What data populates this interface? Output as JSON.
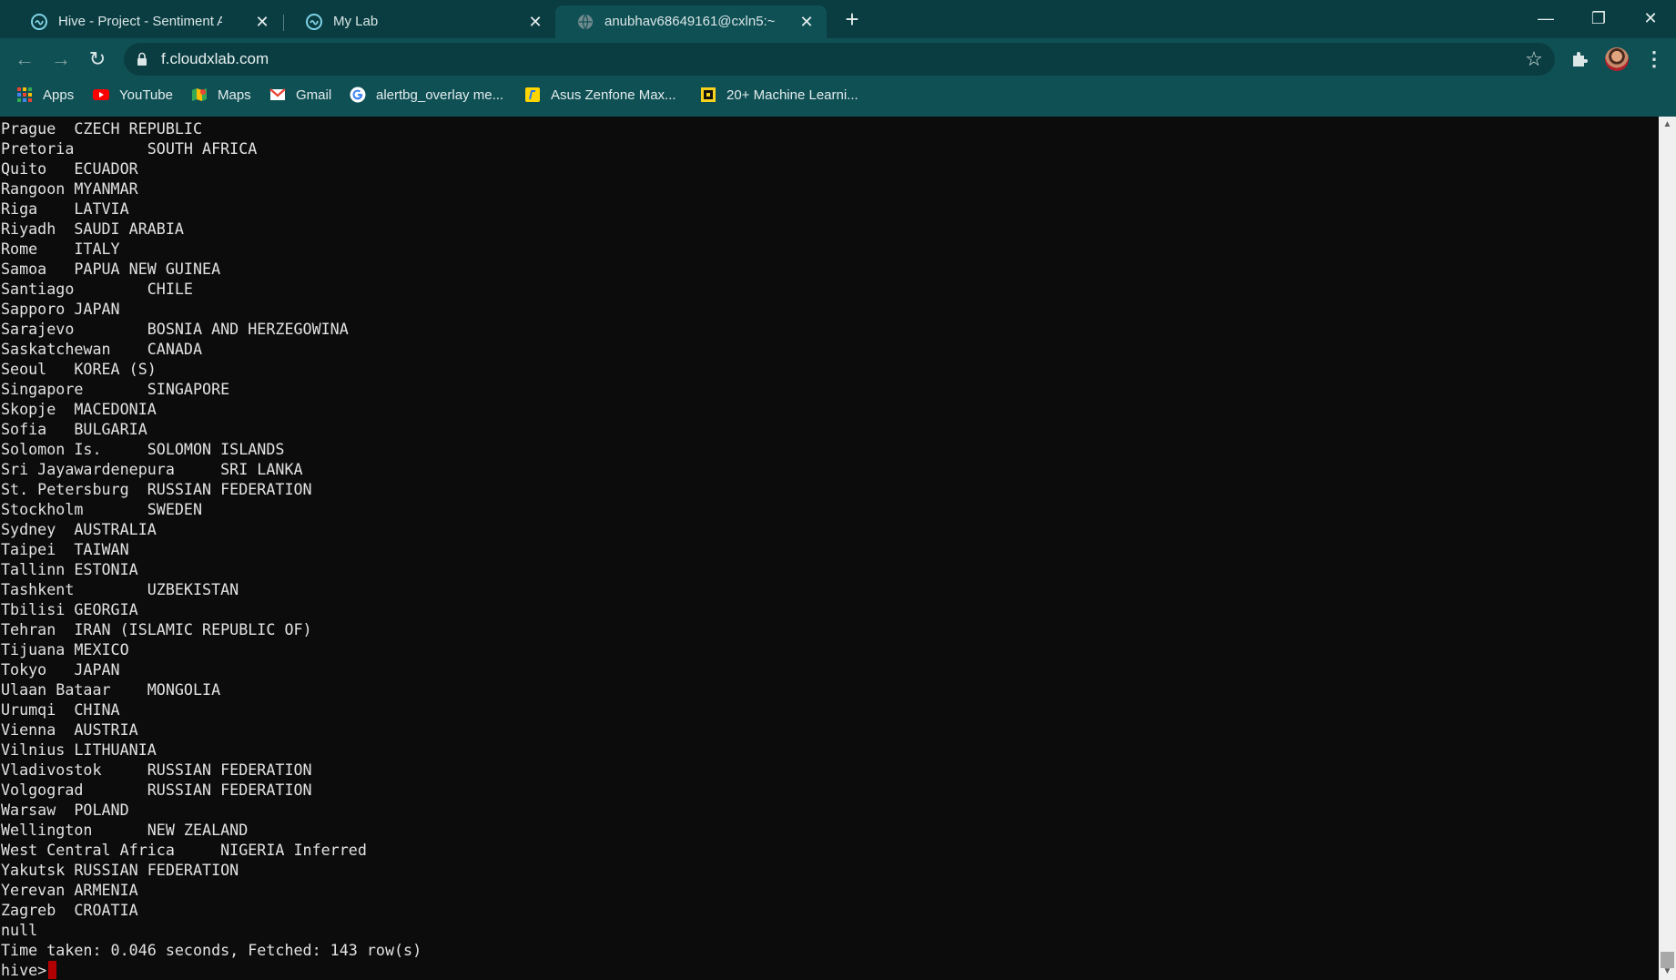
{
  "browser": {
    "tabs": [
      {
        "title": "Hive - Project - Sentiment Analys",
        "favicon": "cloudxlab-icon",
        "active": false
      },
      {
        "title": "My Lab",
        "favicon": "cloudxlab-icon",
        "active": false
      },
      {
        "title": "anubhav68649161@cxln5:~",
        "favicon": "globe-icon",
        "active": true
      }
    ],
    "close_glyph": "✕",
    "new_tab_glyph": "+",
    "window_controls": {
      "minimize": "—",
      "restore": "❐",
      "close": "✕"
    },
    "url": "f.cloudxlab.com",
    "nav": {
      "back": "←",
      "forward": "→",
      "reload": "↻",
      "star": "☆",
      "menu": "⋮"
    },
    "bookmarks": [
      {
        "label": "Apps",
        "icon": "apps-grid-icon"
      },
      {
        "label": "YouTube",
        "icon": "youtube-icon"
      },
      {
        "label": "Maps",
        "icon": "maps-icon"
      },
      {
        "label": "Gmail",
        "icon": "gmail-icon"
      },
      {
        "label": "alertbg_overlay me...",
        "icon": "google-icon"
      },
      {
        "label": "Asus Zenfone Max...",
        "icon": "flipkart-icon"
      },
      {
        "label": "20+ Machine Learni...",
        "icon": "site-icon"
      }
    ],
    "colors": {
      "frame": "#0a3d41",
      "toolbar": "#0f5055",
      "cursor": "#b30000"
    }
  },
  "terminal": {
    "lines": [
      "Prague  CZECH REPUBLIC",
      "Pretoria        SOUTH AFRICA",
      "Quito   ECUADOR",
      "Rangoon MYANMAR",
      "Riga    LATVIA",
      "Riyadh  SAUDI ARABIA",
      "Rome    ITALY",
      "Samoa   PAPUA NEW GUINEA",
      "Santiago        CHILE",
      "Sapporo JAPAN",
      "Sarajevo        BOSNIA AND HERZEGOWINA",
      "Saskatchewan    CANADA",
      "Seoul   KOREA (S)",
      "Singapore       SINGAPORE",
      "Skopje  MACEDONIA",
      "Sofia   BULGARIA",
      "Solomon Is.     SOLOMON ISLANDS",
      "Sri Jayawardenepura     SRI LANKA",
      "St. Petersburg  RUSSIAN FEDERATION",
      "Stockholm       SWEDEN",
      "Sydney  AUSTRALIA",
      "Taipei  TAIWAN",
      "Tallinn ESTONIA",
      "Tashkent        UZBEKISTAN",
      "Tbilisi GEORGIA",
      "Tehran  IRAN (ISLAMIC REPUBLIC OF)",
      "Tijuana MEXICO",
      "Tokyo   JAPAN",
      "Ulaan Bataar    MONGOLIA",
      "Urumqi  CHINA",
      "Vienna  AUSTRIA",
      "Vilnius LITHUANIA",
      "Vladivostok     RUSSIAN FEDERATION",
      "Volgograd       RUSSIAN FEDERATION",
      "Warsaw  POLAND",
      "Wellington      NEW ZEALAND",
      "West Central Africa     NIGERIA Inferred",
      "Yakutsk RUSSIAN FEDERATION",
      "Yerevan ARMENIA",
      "Zagreb  CROATIA",
      "null",
      "Time taken: 0.046 seconds, Fetched: 143 row(s)"
    ],
    "prompt": "hive>"
  }
}
